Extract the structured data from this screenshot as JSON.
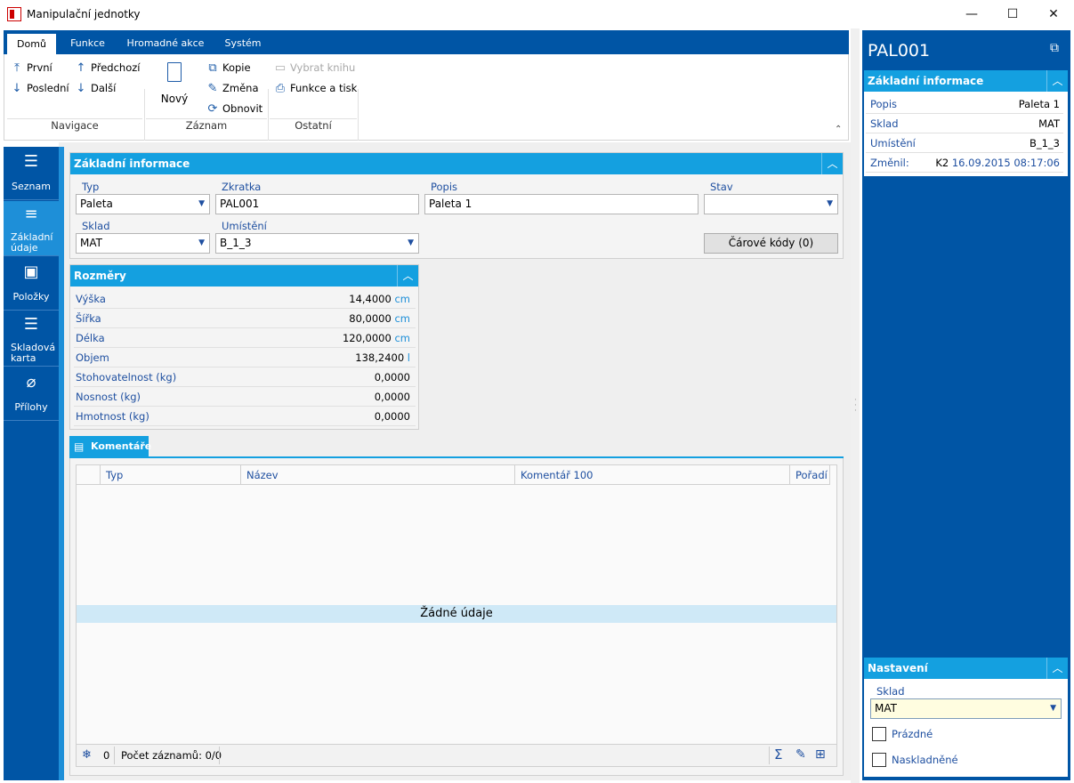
{
  "window": {
    "title": "Manipulační jednotky",
    "minimize": "—",
    "maximize": "☐",
    "close": "✕"
  },
  "ribbon": {
    "tabs": [
      "Domů",
      "Funkce",
      "Hromadné akce",
      "Systém"
    ],
    "nav": {
      "first": "První",
      "last": "Poslední",
      "prev": "Předchozí",
      "next": "Další",
      "group": "Navigace"
    },
    "record": {
      "new": "Nový",
      "copy": "Kopie",
      "change": "Změna",
      "refresh": "Obnovit",
      "group": "Záznam"
    },
    "other": {
      "choose_book": "Vybrat knihu",
      "functions_print": "Funkce a tisk",
      "group": "Ostatní"
    }
  },
  "leftnav": {
    "items": [
      {
        "label": "Seznam"
      },
      {
        "label": "Základní údaje"
      },
      {
        "label": "Položky"
      },
      {
        "label": "Skladová karta"
      },
      {
        "label": "Přílohy"
      }
    ]
  },
  "basic": {
    "title": "Základní informace",
    "type_label": "Typ",
    "type_value": "Paleta",
    "code_label": "Zkratka",
    "code_value": "PAL001",
    "desc_label": "Popis",
    "desc_value": "Paleta 1",
    "state_label": "Stav",
    "state_value": "",
    "warehouse_label": "Sklad",
    "warehouse_value": "MAT",
    "location_label": "Umístění",
    "location_value": "B_1_3",
    "barcodes_button": "Čárové kódy (0)"
  },
  "dimensions": {
    "title": "Rozměry",
    "rows": [
      {
        "label": "Výška",
        "value": "14,4000",
        "unit": "cm"
      },
      {
        "label": "Šířka",
        "value": "80,0000",
        "unit": "cm"
      },
      {
        "label": "Délka",
        "value": "120,0000",
        "unit": "cm"
      },
      {
        "label": "Objem",
        "value": "138,2400",
        "unit": "l"
      },
      {
        "label": "Stohovatelnost (kg)",
        "value": "0,0000",
        "unit": ""
      },
      {
        "label": "Nosnost (kg)",
        "value": "0,0000",
        "unit": ""
      },
      {
        "label": "Hmotnost (kg)",
        "value": "0,0000",
        "unit": ""
      }
    ]
  },
  "comments": {
    "tab": "Komentáře",
    "columns": [
      "Typ",
      "Název",
      "Komentář 100",
      "Pořadí"
    ],
    "empty": "Žádné údaje",
    "count_icon_value": "0",
    "records": "Počet záznamů: 0/0"
  },
  "right": {
    "title": "PAL001",
    "info_title": "Základní informace",
    "rows": [
      {
        "label": "Popis",
        "value": "Paleta 1"
      },
      {
        "label": "Sklad",
        "value": "MAT"
      },
      {
        "label": "Umístění",
        "value": "B_1_3"
      }
    ],
    "changed_label": "Změnil:",
    "changed_user": "K2",
    "changed_date": "16.09.2015 08:17:06",
    "settings_title": "Nastavení",
    "settings_warehouse_label": "Sklad",
    "settings_warehouse_value": "MAT",
    "empty_label": "Prázdné",
    "stocked_label": "Naskladněné"
  },
  "colors": {
    "brand": "#0055a5",
    "accent": "#14a0e0"
  }
}
